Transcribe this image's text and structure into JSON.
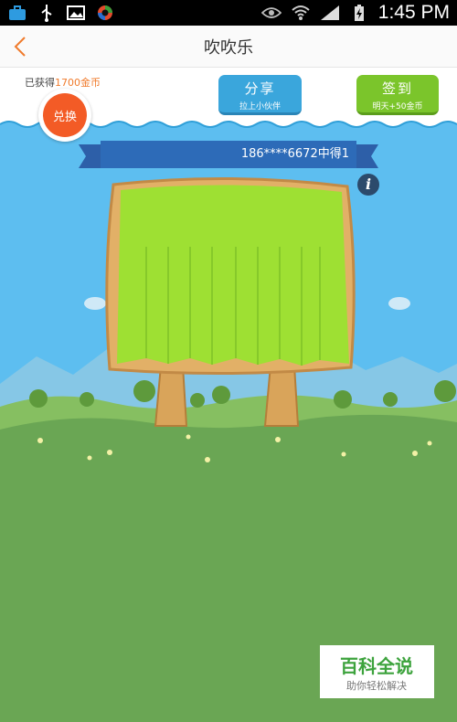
{
  "status_bar": {
    "time": "1:45 PM",
    "icons": [
      "briefcase-icon",
      "usb-icon",
      "image-icon",
      "app-icon",
      "eye-icon",
      "wifi-icon",
      "signal-icon",
      "battery-icon"
    ]
  },
  "nav": {
    "title": "吹吹乐"
  },
  "header": {
    "earned_prefix": "已获得",
    "earned_coins": "1700金币",
    "exchange_label": "兑换",
    "share": {
      "label": "分享",
      "sub": "拉上小伙伴"
    },
    "sign_in": {
      "label": "签到",
      "sub": "明天+50金币"
    }
  },
  "ticker": {
    "text": "186****6672中得1"
  },
  "info_label": "i",
  "watermark": {
    "title": "百科全说",
    "subtitle": "助你轻松解决"
  },
  "colors": {
    "accent_orange": "#f07b2c",
    "share_blue": "#3aa6dc",
    "sign_green": "#7bc52b",
    "sky": "#5dbef0",
    "grass": "#6aa654"
  }
}
